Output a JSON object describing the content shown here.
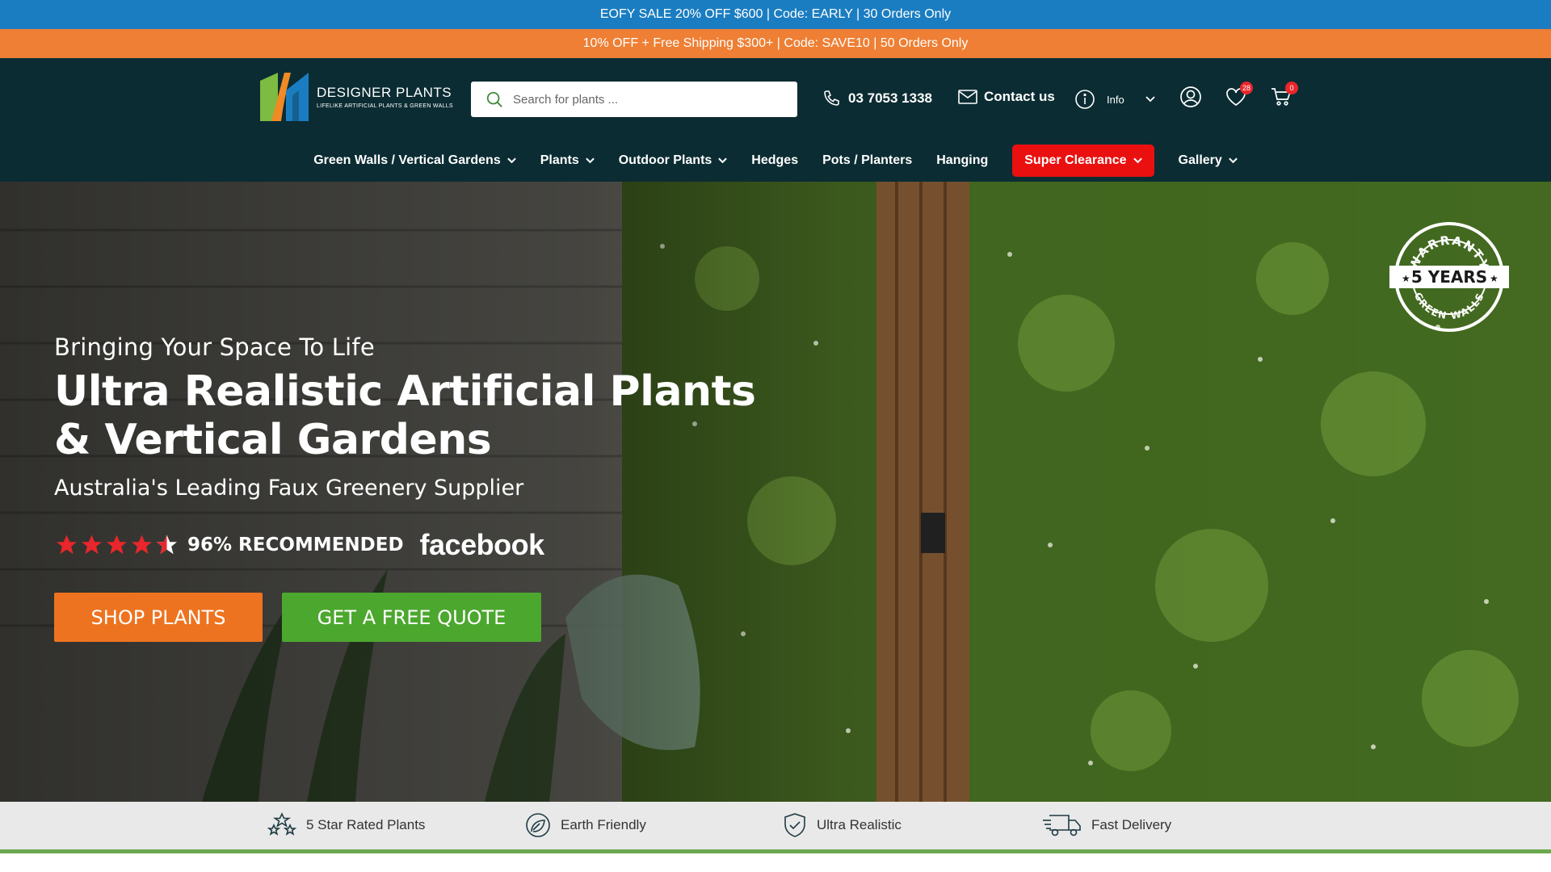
{
  "promo": {
    "top": "EOFY SALE 20% OFF $600 | Code: EARLY | 30 Orders Only",
    "second": "10% OFF + Free Shipping $300+ | Code: SAVE10 | 50 Orders Only"
  },
  "header": {
    "logo_title": "DESIGNER PLANTS",
    "logo_sub": "LIFELIKE ARTIFICIAL PLANTS & GREEN WALLS",
    "search_placeholder": "Search for plants ...",
    "phone": "03 7053 1338",
    "contact": "Contact us",
    "info": "Info",
    "wishlist_count": "28",
    "cart_count": "0"
  },
  "nav": {
    "items": [
      {
        "label": "Green Walls / Vertical Gardens",
        "dropdown": true
      },
      {
        "label": "Plants",
        "dropdown": true
      },
      {
        "label": "Outdoor Plants",
        "dropdown": true
      },
      {
        "label": "Hedges",
        "dropdown": false
      },
      {
        "label": "Pots / Planters",
        "dropdown": false
      },
      {
        "label": "Hanging",
        "dropdown": false
      },
      {
        "label": "Super Clearance",
        "dropdown": true
      },
      {
        "label": "Gallery",
        "dropdown": true
      }
    ]
  },
  "hero": {
    "pre": "Bringing Your Space To Life",
    "title_line1": "Ultra Realistic Artificial Plants",
    "title_line2": "& Vertical Gardens",
    "subtitle": "Australia's Leading Faux Greenery Supplier",
    "rating_stars": 4.5,
    "recommended": "96% RECOMMENDED",
    "facebook": "facebook",
    "btn_shop": "SHOP PLANTS",
    "btn_quote": "GET A FREE QUOTE",
    "warranty_top": "WARRANTY",
    "warranty_mid": "5 YEARS",
    "warranty_bottom": "GREEN WALLS"
  },
  "features": [
    {
      "label": "5 Star Rated Plants",
      "icon": "stars-icon"
    },
    {
      "label": "Earth Friendly",
      "icon": "earth-leaf-icon"
    },
    {
      "label": "Ultra Realistic",
      "icon": "shield-check-icon"
    },
    {
      "label": "Fast Delivery",
      "icon": "delivery-truck-icon"
    }
  ],
  "colors": {
    "promo_blue": "#1b7dc1",
    "promo_orange": "#ee7f34",
    "header_bg": "#0b2c33",
    "clearance_red": "#ea1010",
    "shop_orange": "#ee7320",
    "quote_green": "#4ca72f"
  }
}
